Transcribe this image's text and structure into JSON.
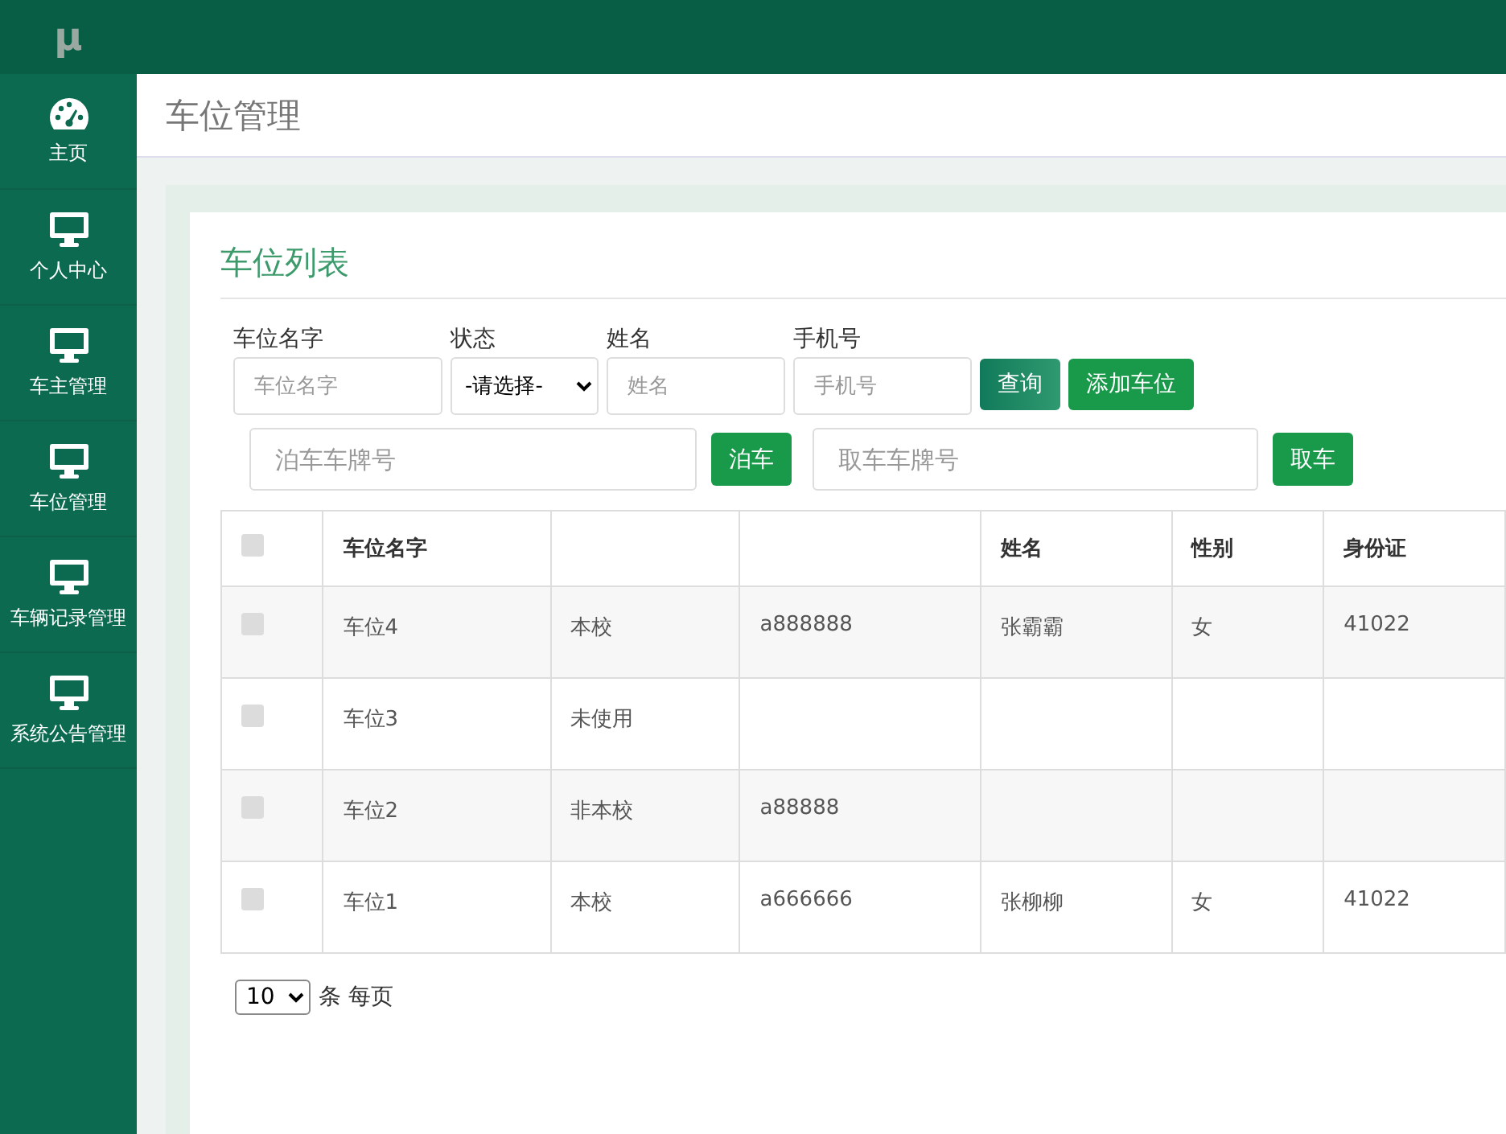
{
  "logo": "μ",
  "sidebar": {
    "items": [
      {
        "label": "主页",
        "kind": "dashboard",
        "selected": false
      },
      {
        "label": "个人中心",
        "kind": "monitor",
        "selected": false
      },
      {
        "label": "车主管理",
        "kind": "monitor",
        "selected": false
      },
      {
        "label": "车位管理",
        "kind": "monitor",
        "selected": false
      },
      {
        "label": "车辆记录管理",
        "kind": "monitor",
        "selected": false
      },
      {
        "label": "系统公告管理",
        "kind": "monitor",
        "selected": false
      }
    ]
  },
  "page_title": "车位管理",
  "card_title": "车位列表",
  "filters": [
    {
      "label": "车位名字",
      "kind": "input",
      "placeholder": "车位名字"
    },
    {
      "label": "状态",
      "kind": "select",
      "value": "-请选择-"
    },
    {
      "label": "姓名",
      "kind": "input",
      "placeholder": "姓名"
    },
    {
      "label": "手机号",
      "kind": "input",
      "placeholder": "手机号"
    }
  ],
  "filter_buttons": [
    {
      "label": "查询",
      "kind": "query"
    },
    {
      "label": "添加车位",
      "kind": "add"
    }
  ],
  "park": {
    "placeholder": "泊车车牌号",
    "button": "泊车"
  },
  "pickup": {
    "placeholder": "取车车牌号",
    "button": "取车"
  },
  "table": {
    "header_checked": false,
    "columns": [
      "车位名字",
      "",
      "",
      "姓名",
      "性别",
      "身份证"
    ],
    "rows": [
      {
        "checked": false,
        "cells": [
          "车位4",
          "本校",
          "a888888",
          "张霸霸",
          "女",
          "41022"
        ]
      },
      {
        "checked": false,
        "cells": [
          "车位3",
          "未使用",
          "",
          "",
          "",
          ""
        ]
      },
      {
        "checked": false,
        "cells": [
          "车位2",
          "非本校",
          "a88888",
          "",
          "",
          ""
        ]
      },
      {
        "checked": false,
        "cells": [
          "车位1",
          "本校",
          "a666666",
          "张柳柳",
          "女",
          "41022"
        ]
      }
    ]
  },
  "pagination": {
    "page_size": "10",
    "suffix": "条 每页"
  }
}
